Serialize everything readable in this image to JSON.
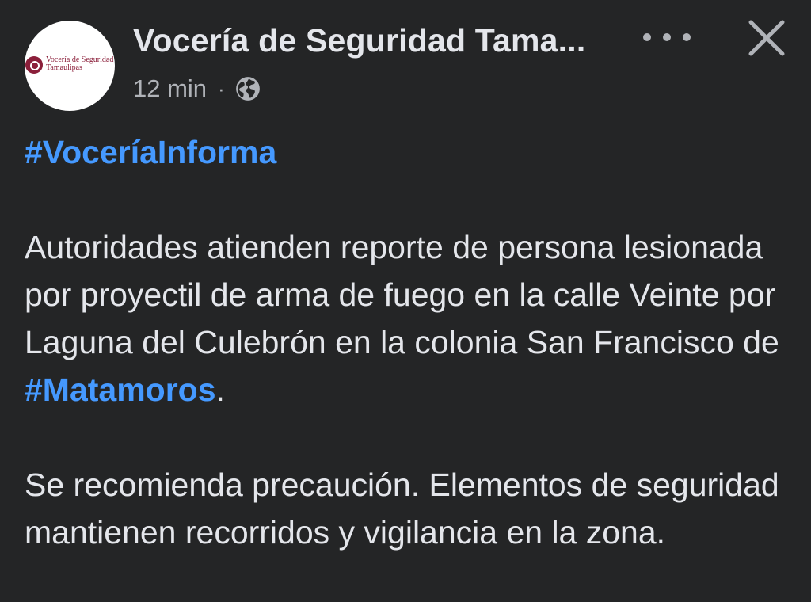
{
  "post": {
    "author": "Vocería de Seguridad Tama...",
    "timestamp": "12 min",
    "separator": "·",
    "privacy_icon": "globe-icon",
    "avatar": {
      "line1": "Vocería de Seguridad",
      "line2": "Tamaulipas",
      "brand_color": "#8b1f3a"
    },
    "more_icon": "more-dots-icon",
    "close_icon": "close-icon",
    "hashtag1": "#VoceríaInforma",
    "paragraph1_text": "Autoridades atienden reporte de persona lesionada por proyectil de arma de fuego en la calle Veinte por Laguna del Culebrón en la colonia San Francisco de ",
    "paragraph1_hashtag": "#Matamoros",
    "paragraph1_end": ".",
    "paragraph2": "Se recomienda precaución. Elementos de seguridad mantienen recorridos y vigilancia en la zona."
  },
  "colors": {
    "background": "#242526",
    "text": "#e4e6eb",
    "secondary_text": "#b0b3b8",
    "link": "#4599ff"
  }
}
